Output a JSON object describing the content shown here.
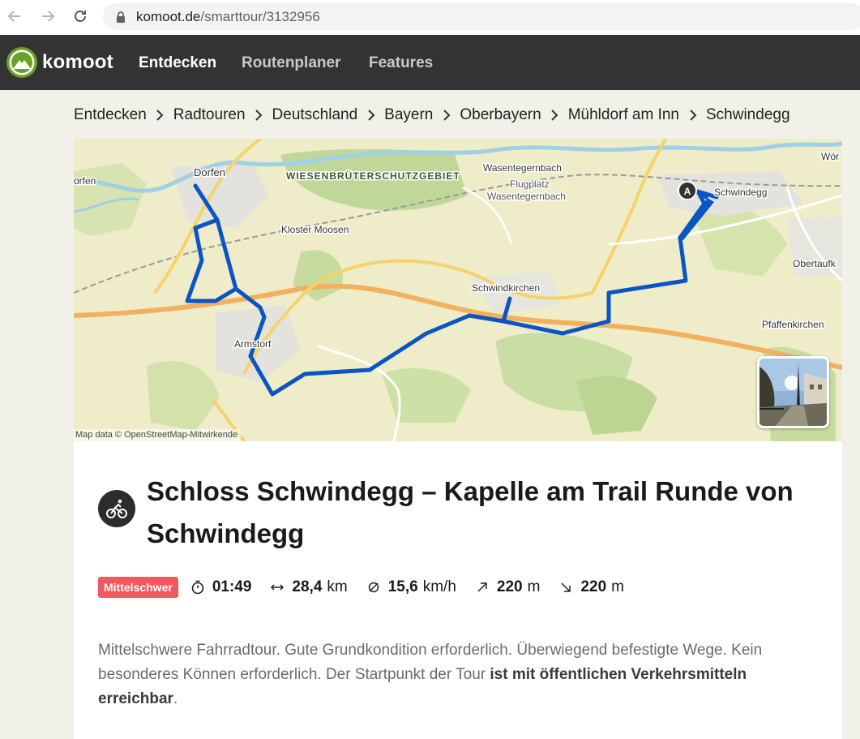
{
  "browser": {
    "url_host": "komoot.de",
    "url_path": "/smarttour/3132956"
  },
  "header": {
    "brand": "komoot",
    "nav": [
      "Entdecken",
      "Routenplaner",
      "Features"
    ]
  },
  "breadcrumb": [
    "Entdecken",
    "Radtouren",
    "Deutschland",
    "Bayern",
    "Oberbayern",
    "Mühldorf am Inn",
    "Schwindegg"
  ],
  "map": {
    "labels": {
      "dorfen": "Dorfen",
      "wiesen": "WIESENBRÜTERSCHUTZGEBIET",
      "wasentegernbach": "Wasentegernbach",
      "flugplatz": "Flugplatz",
      "flugplatz2": "Wasentegernbach",
      "kloster": "Kloster Moosen",
      "schwindkirchen": "Schwindkirchen",
      "armstorf": "Armstorf",
      "schwindegg": "Schwindegg",
      "obertaufk": "Obertaufk",
      "pfaffenkirchen": "Pfaffenkirchen",
      "woer": "Wör",
      "dorfen_left": "orfen",
      "marker": "A"
    },
    "attribution": "Map data © OpenStreetMap-Mitwirkende",
    "route_color": "#0a55c4"
  },
  "tour": {
    "title": "Schloss Schwindegg – Kapelle am Trail Runde von Schwindegg",
    "difficulty": "Mittelschwer",
    "duration": "01:49",
    "distance": "28,4",
    "distance_unit": "km",
    "speed": "15,6",
    "speed_unit": "km/h",
    "ascent": "220",
    "ascent_unit": "m",
    "descent": "220",
    "descent_unit": "m",
    "desc_plain": "Mittelschwere Fahrradtour. Gute Grundkondition erforderlich. Überwiegend befestigte Wege. Kein besonderes Können erforderlich. Der Startpunkt der Tour ",
    "desc_bold": "ist mit öffentlichen Verkehrsmitteln erreichbar",
    "desc_end": "."
  },
  "colors": {
    "header_bg": "#333333",
    "brand_green": "#6aa127",
    "badge": "#f05a5f",
    "page_bg": "#f1f1ea"
  }
}
